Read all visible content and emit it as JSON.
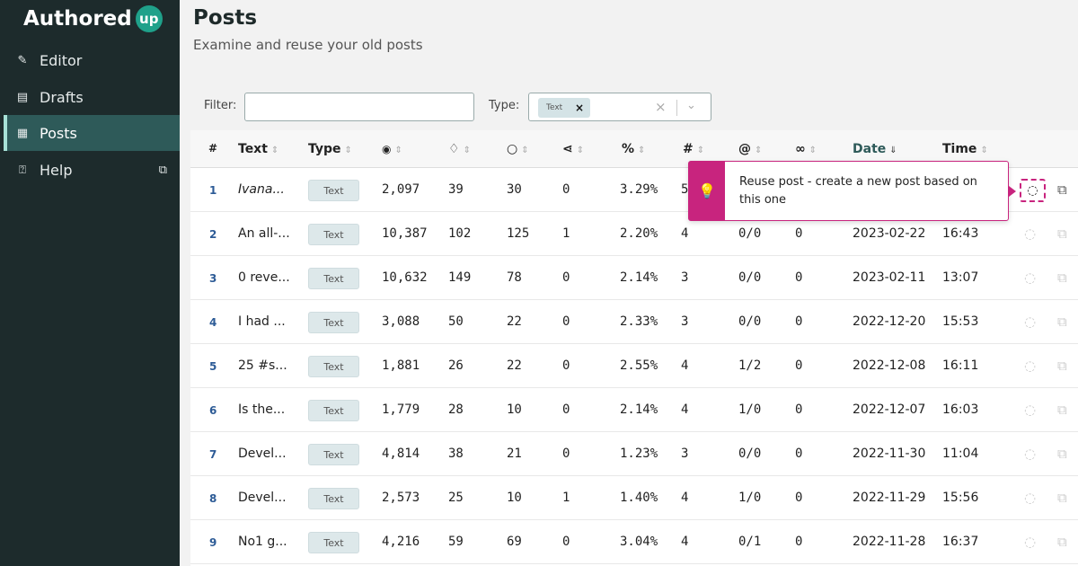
{
  "app": {
    "name": "Authored",
    "badge": "up"
  },
  "sidebar": {
    "items": [
      {
        "label": "Editor",
        "icon": "pen-icon"
      },
      {
        "label": "Drafts",
        "icon": "drafts-icon"
      },
      {
        "label": "Posts",
        "icon": "posts-icon",
        "active": true
      },
      {
        "label": "Help",
        "icon": "help-icon",
        "external": true
      }
    ]
  },
  "page": {
    "title": "Posts",
    "subtitle": "Examine and reuse your old posts"
  },
  "filters": {
    "filter_label": "Filter:",
    "filter_value": "",
    "type_label": "Type:",
    "type_chip": "Text"
  },
  "table": {
    "headers": {
      "num": "#",
      "text": "Text",
      "type": "Type",
      "views": "👁",
      "likes": "👍",
      "comments": "💬",
      "shares": "⟨⟩",
      "percent": "%",
      "hashtags": "#",
      "mentions": "@",
      "links": "🔗",
      "date": "Date",
      "time": "Time"
    },
    "rows": [
      {
        "num": "1",
        "text": "Ivana...",
        "type": "Text",
        "views": "2,097",
        "likes": "39",
        "comments": "30",
        "shares": "0",
        "percent": "3.29%",
        "hashtags": "5",
        "mentions": "",
        "links": "",
        "date": "",
        "time": ""
      },
      {
        "num": "2",
        "text": "An all-...",
        "type": "Text",
        "views": "10,387",
        "likes": "102",
        "comments": "125",
        "shares": "1",
        "percent": "2.20%",
        "hashtags": "4",
        "mentions": "0/0",
        "links": "0",
        "date": "2023-02-22",
        "time": "16:43"
      },
      {
        "num": "3",
        "text": "0 reve...",
        "type": "Text",
        "views": "10,632",
        "likes": "149",
        "comments": "78",
        "shares": "0",
        "percent": "2.14%",
        "hashtags": "3",
        "mentions": "0/0",
        "links": "0",
        "date": "2023-02-11",
        "time": "13:07"
      },
      {
        "num": "4",
        "text": "I had ...",
        "type": "Text",
        "views": "3,088",
        "likes": "50",
        "comments": "22",
        "shares": "0",
        "percent": "2.33%",
        "hashtags": "3",
        "mentions": "0/0",
        "links": "0",
        "date": "2022-12-20",
        "time": "15:53"
      },
      {
        "num": "5",
        "text": "25 #s...",
        "type": "Text",
        "views": "1,881",
        "likes": "26",
        "comments": "22",
        "shares": "0",
        "percent": "2.55%",
        "hashtags": "4",
        "mentions": "1/2",
        "links": "0",
        "date": "2022-12-08",
        "time": "16:11"
      },
      {
        "num": "6",
        "text": "Is the...",
        "type": "Text",
        "views": "1,779",
        "likes": "28",
        "comments": "10",
        "shares": "0",
        "percent": "2.14%",
        "hashtags": "4",
        "mentions": "1/0",
        "links": "0",
        "date": "2022-12-07",
        "time": "16:03"
      },
      {
        "num": "7",
        "text": "Devel...",
        "type": "Text",
        "views": "4,814",
        "likes": "38",
        "comments": "21",
        "shares": "0",
        "percent": "1.23%",
        "hashtags": "3",
        "mentions": "0/0",
        "links": "0",
        "date": "2022-11-30",
        "time": "11:04"
      },
      {
        "num": "8",
        "text": "Devel...",
        "type": "Text",
        "views": "2,573",
        "likes": "25",
        "comments": "10",
        "shares": "1",
        "percent": "1.40%",
        "hashtags": "4",
        "mentions": "1/0",
        "links": "0",
        "date": "2022-11-29",
        "time": "15:56"
      },
      {
        "num": "9",
        "text": "No1 g...",
        "type": "Text",
        "views": "4,216",
        "likes": "59",
        "comments": "69",
        "shares": "0",
        "percent": "3.04%",
        "hashtags": "4",
        "mentions": "0/1",
        "links": "0",
        "date": "2022-11-28",
        "time": "16:37"
      }
    ]
  },
  "tooltip": {
    "text": "Reuse post - create a new post based on this one",
    "icon": "lightbulb-icon"
  },
  "colors": {
    "sidebar_bg": "#1d2b2c",
    "active_bg": "#2e5a59",
    "accent": "#c8247e",
    "brand": "#1fa18a"
  }
}
